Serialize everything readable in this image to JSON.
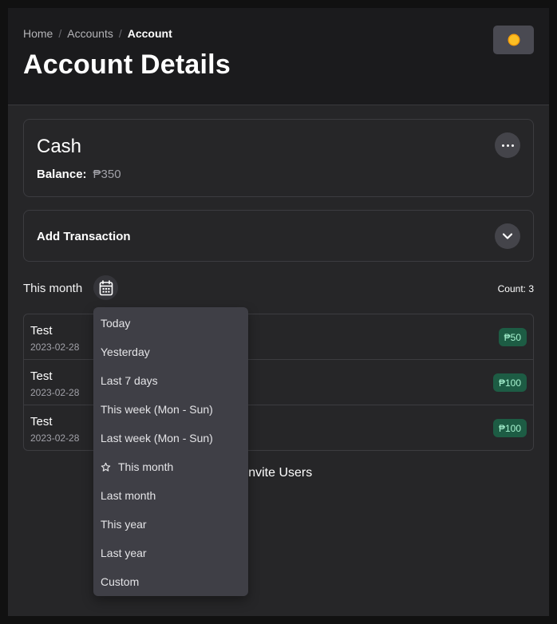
{
  "header": {
    "breadcrumb": [
      {
        "label": "Home"
      },
      {
        "label": "Accounts"
      },
      {
        "label": "Account"
      }
    ],
    "separator": "/",
    "title": "Account Details",
    "theme_toggle_icon": "sun-icon"
  },
  "account": {
    "name": "Cash",
    "balance_label": "Balance:",
    "balance_value": "₱350",
    "more_icon": "ellipsis-icon"
  },
  "add_transaction": {
    "title": "Add Transaction",
    "expand_icon": "chevron-down-icon"
  },
  "filter": {
    "current": "This month",
    "icon": "calendar-icon",
    "count_label": "Count: 3"
  },
  "transactions": [
    {
      "name": "Test",
      "date": "2023-02-28",
      "amount": "₱50"
    },
    {
      "name": "Test",
      "date": "2023-02-28",
      "amount": "₱100"
    },
    {
      "name": "Test",
      "date": "2023-02-28",
      "amount": "₱100"
    }
  ],
  "invite": {
    "label": "Invite Users"
  },
  "dropdown": {
    "items": [
      {
        "label": "Today",
        "selected": false
      },
      {
        "label": "Yesterday",
        "selected": false
      },
      {
        "label": "Last 7 days",
        "selected": false
      },
      {
        "label": "This week (Mon - Sun)",
        "selected": false
      },
      {
        "label": "Last week (Mon - Sun)",
        "selected": false
      },
      {
        "label": "This month",
        "selected": true
      },
      {
        "label": "Last month",
        "selected": false
      },
      {
        "label": "This year",
        "selected": false
      },
      {
        "label": "Last year",
        "selected": false
      },
      {
        "label": "Custom",
        "selected": false
      }
    ]
  },
  "colors": {
    "accent_badge_bg": "#1d5c44",
    "accent_badge_text": "#a7f3d0",
    "sun": "#fbbf24"
  }
}
